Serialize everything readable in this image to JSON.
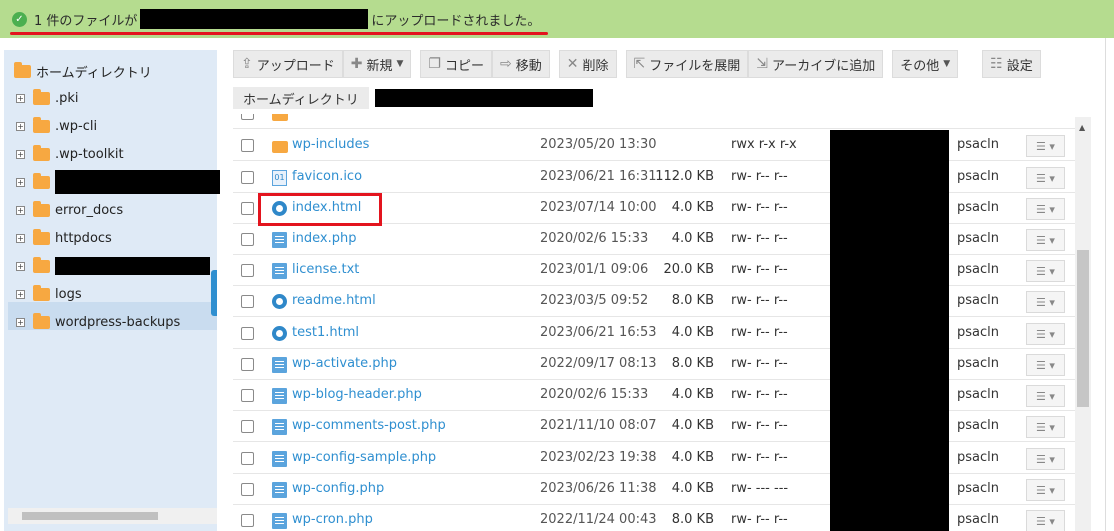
{
  "banner": {
    "message_prefix": "1 件のファイルが",
    "message_suffix": "にアップロードされました。"
  },
  "sidebar": {
    "root_label": "ホームディレクトリ",
    "items": [
      {
        "label": ".pki"
      },
      {
        "label": ".wp-cli"
      },
      {
        "label": ".wp-toolkit"
      },
      {
        "label": ""
      },
      {
        "label": "error_docs"
      },
      {
        "label": "httpdocs"
      },
      {
        "label": ""
      },
      {
        "label": "logs"
      },
      {
        "label": "wordpress-backups"
      }
    ]
  },
  "toolbar": {
    "upload": "アップロード",
    "new": "新規",
    "copy": "コピー",
    "move": "移動",
    "delete": "削除",
    "extract": "ファイルを展開",
    "archive": "アーカイブに追加",
    "more": "その他",
    "settings": "設定"
  },
  "breadcrumb": {
    "home": "ホームディレクトリ"
  },
  "files": [
    {
      "name": "wp-includes",
      "type": "folder",
      "date": "2023/05/20 13:30",
      "size": "",
      "perm": "rwx r-x r-x",
      "owner": "psacln"
    },
    {
      "name": "favicon.ico",
      "type": "ico",
      "date": "2023/06/21 16:31",
      "size": "112.0 KB",
      "perm": "rw- r-- r--",
      "owner": "psacln"
    },
    {
      "name": "index.html",
      "type": "html",
      "date": "2023/07/14 10:00",
      "size": "4.0 KB",
      "perm": "rw- r-- r--",
      "owner": "psacln"
    },
    {
      "name": "index.php",
      "type": "doc",
      "date": "2020/02/6 15:33",
      "size": "4.0 KB",
      "perm": "rw- r-- r--",
      "owner": "psacln"
    },
    {
      "name": "license.txt",
      "type": "doc",
      "date": "2023/01/1 09:06",
      "size": "20.0 KB",
      "perm": "rw- r-- r--",
      "owner": "psacln"
    },
    {
      "name": "readme.html",
      "type": "html",
      "date": "2023/03/5 09:52",
      "size": "8.0 KB",
      "perm": "rw- r-- r--",
      "owner": "psacln"
    },
    {
      "name": "test1.html",
      "type": "html",
      "date": "2023/06/21 16:53",
      "size": "4.0 KB",
      "perm": "rw- r-- r--",
      "owner": "psacln"
    },
    {
      "name": "wp-activate.php",
      "type": "doc",
      "date": "2022/09/17 08:13",
      "size": "8.0 KB",
      "perm": "rw- r-- r--",
      "owner": "psacln"
    },
    {
      "name": "wp-blog-header.php",
      "type": "doc",
      "date": "2020/02/6 15:33",
      "size": "4.0 KB",
      "perm": "rw- r-- r--",
      "owner": "psacln"
    },
    {
      "name": "wp-comments-post.php",
      "type": "doc",
      "date": "2021/11/10 08:07",
      "size": "4.0 KB",
      "perm": "rw- r-- r--",
      "owner": "psacln"
    },
    {
      "name": "wp-config-sample.php",
      "type": "doc",
      "date": "2023/02/23 19:38",
      "size": "4.0 KB",
      "perm": "rw- r-- r--",
      "owner": "psacln"
    },
    {
      "name": "wp-config.php",
      "type": "doc",
      "date": "2023/06/26 11:38",
      "size": "4.0 KB",
      "perm": "rw- --- ---",
      "owner": "psacln"
    },
    {
      "name": "wp-cron.php",
      "type": "doc",
      "date": "2022/11/24 00:43",
      "size": "8.0 KB",
      "perm": "rw- r-- r--",
      "owner": "psacln"
    }
  ]
}
